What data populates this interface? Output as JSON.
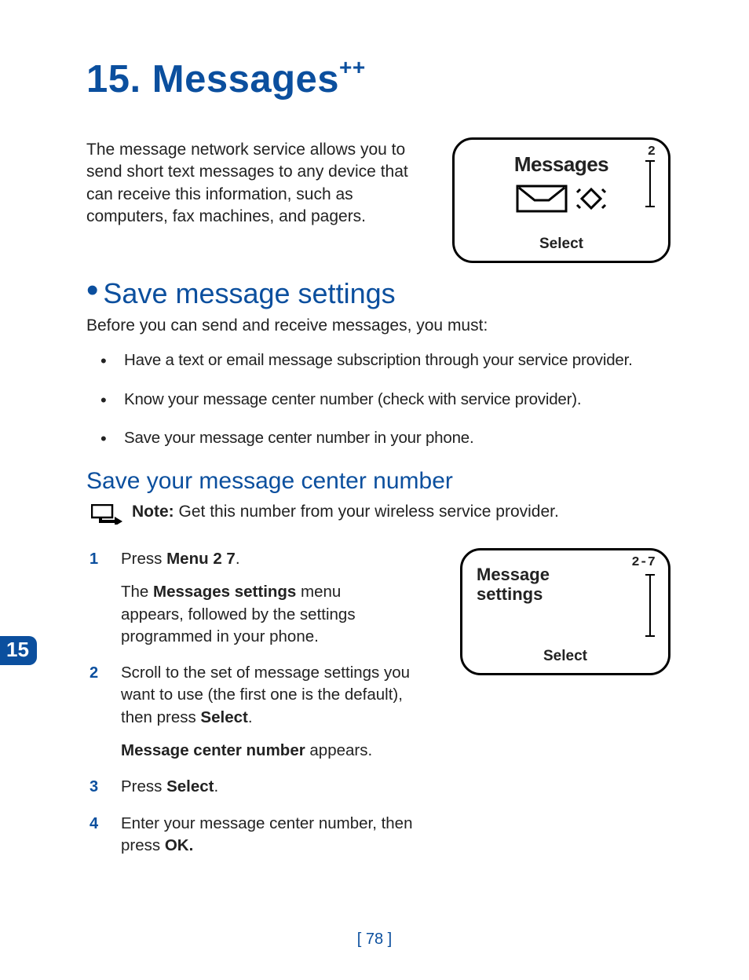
{
  "chapter": {
    "number": "15.",
    "title": "Messages",
    "sup": "++"
  },
  "intro": "The message network service allows you to send short text messages to any device that can receive this information, such as computers, fax machines, and pagers.",
  "screen1": {
    "title": "Messages",
    "select": "Select",
    "digit": "2"
  },
  "section": {
    "title": "Save message settings",
    "lead": "Before you can send and receive messages, you must:",
    "reqs": [
      "Have a text or email message subscription through your service provider.",
      "Know your message center number (check with service provider).",
      "Save your message center number in your phone."
    ]
  },
  "sub": {
    "title": "Save your message center number",
    "note_label": "Note:",
    "note_text": " Get this number from your wireless service provider."
  },
  "screen2": {
    "title1": "Message",
    "title2": "settings",
    "select": "Select",
    "digit": "2-7"
  },
  "steps": {
    "s1a": "Press ",
    "s1b": "Menu 2 7",
    "s1c": ".",
    "s1_sub_a": "The ",
    "s1_sub_b": "Messages settings",
    "s1_sub_c": " menu appears, followed by the settings programmed in your phone.",
    "s2a": "Scroll to the set of message settings you want to use (the first one is the default), then press ",
    "s2b": "Select",
    "s2c": ".",
    "s2_sub_a": "Message center number",
    "s2_sub_b": " appears.",
    "s3a": "Press ",
    "s3b": "Select",
    "s3c": ".",
    "s4a": "Enter your message center number, then press ",
    "s4b": "OK."
  },
  "tab": "15",
  "page": "[ 78 ]"
}
